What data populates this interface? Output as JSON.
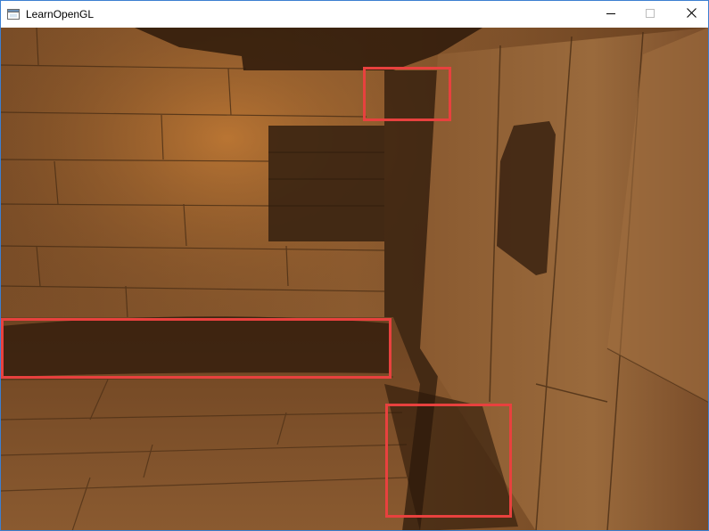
{
  "window": {
    "title": "LearnOpenGL",
    "app_icon": "application-window-icon",
    "controls": {
      "minimize_icon": "minimize-icon",
      "maximize_icon": "maximize-icon",
      "close_icon": "close-icon"
    }
  },
  "scene": {
    "description_icon": "opengl-render-canvas",
    "annotation_color": "#e8413e",
    "annotation_boxes": 3
  }
}
